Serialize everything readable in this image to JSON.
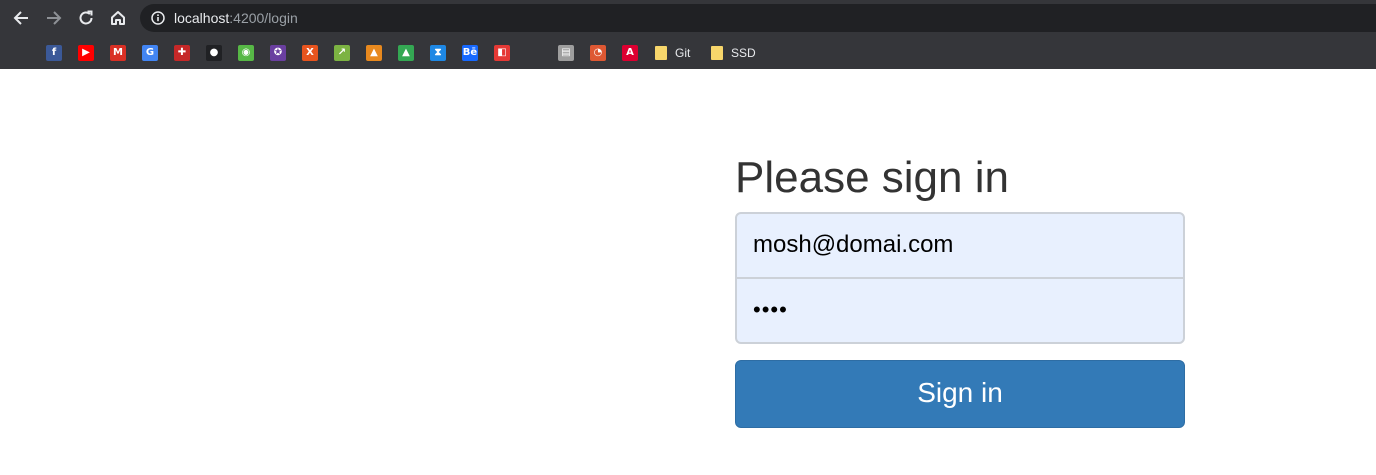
{
  "browser": {
    "url_host": "localhost",
    "url_path": ":4200/login",
    "nav_icons": [
      "back-arrow-icon",
      "forward-arrow-icon",
      "reload-icon",
      "home-icon"
    ],
    "info_icon": "info-icon",
    "bookmarks": [
      {
        "icon": "facebook-icon",
        "glyph": "f",
        "color": "#3b5998"
      },
      {
        "icon": "youtube-icon",
        "glyph": "▶",
        "color": "#ff0000"
      },
      {
        "icon": "gmail-icon",
        "glyph": "M",
        "color": "#d93025"
      },
      {
        "icon": "google-translate-icon",
        "glyph": "G",
        "color": "#4285f4"
      },
      {
        "icon": "gamepad-icon",
        "glyph": "✚",
        "color": "#c62828"
      },
      {
        "icon": "incognito-icon",
        "glyph": "●",
        "color": "#202124"
      },
      {
        "icon": "owl-icon",
        "glyph": "◉",
        "color": "#57b846"
      },
      {
        "icon": "badge-icon",
        "glyph": "✪",
        "color": "#6a3fa0"
      },
      {
        "icon": "x-icon",
        "glyph": "X",
        "color": "#e8541e"
      },
      {
        "icon": "graph-icon",
        "glyph": "↗",
        "color": "#7cb342"
      },
      {
        "icon": "mountain-icon",
        "glyph": "▲",
        "color": "#e8891e"
      },
      {
        "icon": "google-drive-icon",
        "glyph": "▲",
        "color": "#34a853"
      },
      {
        "icon": "hourglass-icon",
        "glyph": "⧗",
        "color": "#1e88e5"
      },
      {
        "icon": "behance-icon",
        "glyph": "Bē",
        "color": "#1769ff"
      },
      {
        "icon": "puzzle-icon",
        "glyph": "◧",
        "color": "#e53935"
      },
      {
        "icon": "printer-icon",
        "glyph": "▤",
        "color": "#9e9e9e"
      },
      {
        "icon": "duckduckgo-icon",
        "glyph": "◔",
        "color": "#de5833"
      },
      {
        "icon": "angular-icon",
        "glyph": "A",
        "color": "#dd0031"
      }
    ],
    "folders": [
      {
        "label": "Git"
      },
      {
        "label": "SSD"
      }
    ]
  },
  "form": {
    "heading": "Please sign in",
    "email_value": "mosh@domai.com",
    "password_value": "••••",
    "submit_label": "Sign in"
  }
}
